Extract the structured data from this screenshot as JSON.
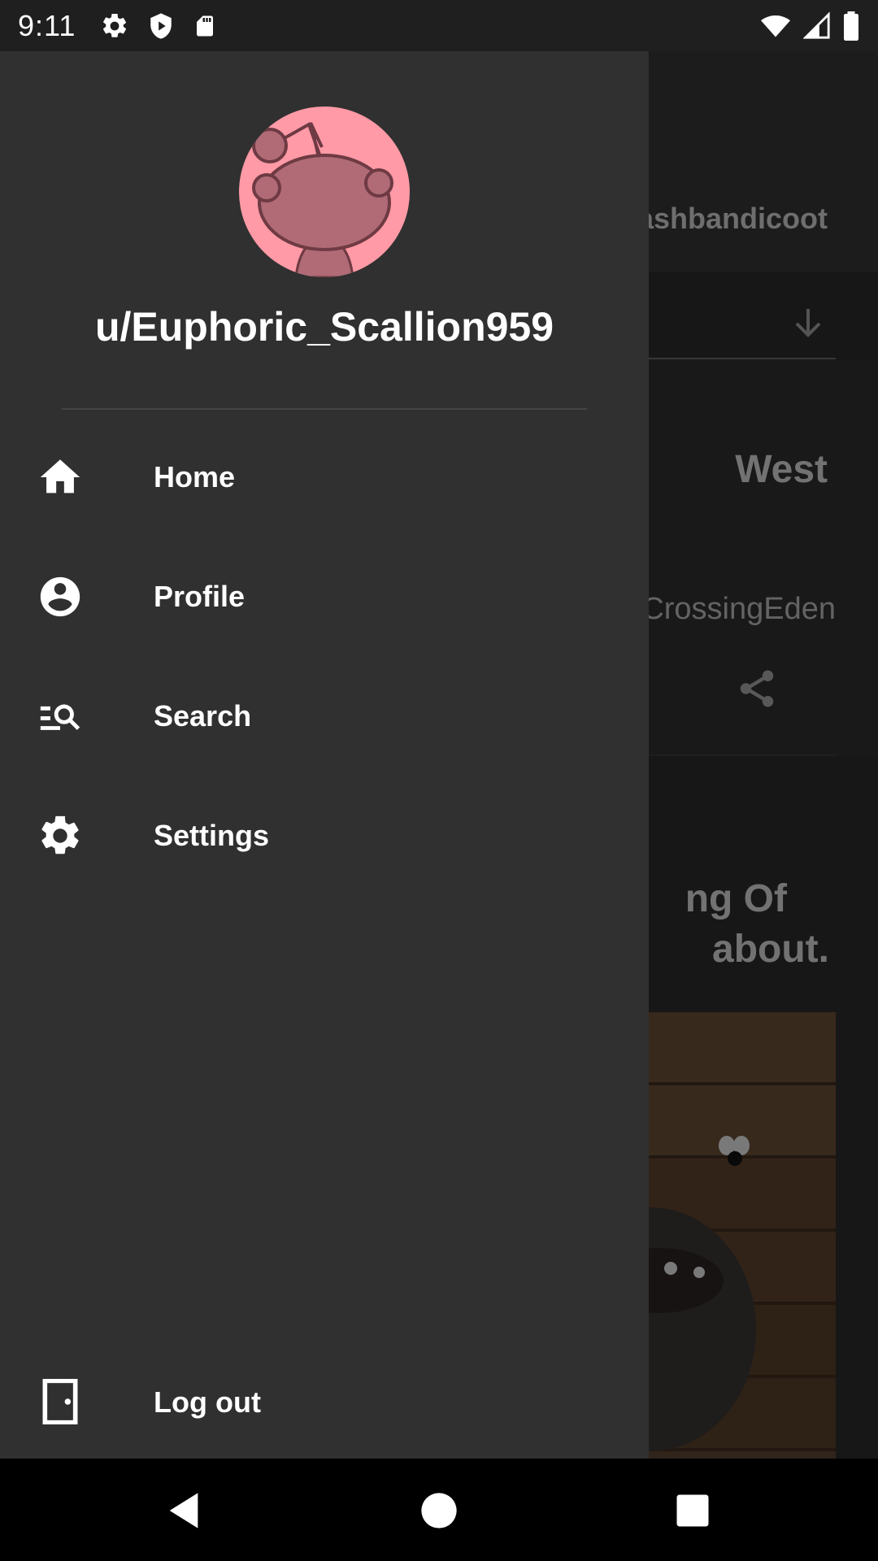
{
  "status_bar": {
    "time": "9:11",
    "left_icons": [
      "settings-gear-icon",
      "shield-icon",
      "sd-card-icon"
    ],
    "right_icons": [
      "wifi-icon",
      "cell-signal-icon",
      "battery-icon"
    ]
  },
  "background": {
    "subreddit_fragment": "ashbandicoot",
    "post1_title_fragment": "West",
    "post1_user_fragment": "CrossingEden",
    "post2_line1_fragment": "ng Of",
    "post2_line2_fragment": "about."
  },
  "drawer": {
    "username": "u/Euphoric_Scallion959",
    "items": [
      {
        "label": "Home",
        "icon": "home-icon"
      },
      {
        "label": "Profile",
        "icon": "account-circle-icon"
      },
      {
        "label": "Search",
        "icon": "manage-search-icon"
      },
      {
        "label": "Settings",
        "icon": "settings-icon"
      }
    ],
    "logout": {
      "label": "Log out",
      "icon": "door-icon"
    }
  },
  "colors": {
    "drawer_bg": "#303030",
    "avatar_bg": "#ff9aa6",
    "avatar_snoo": "#b06b76",
    "text": "#ffffff"
  }
}
